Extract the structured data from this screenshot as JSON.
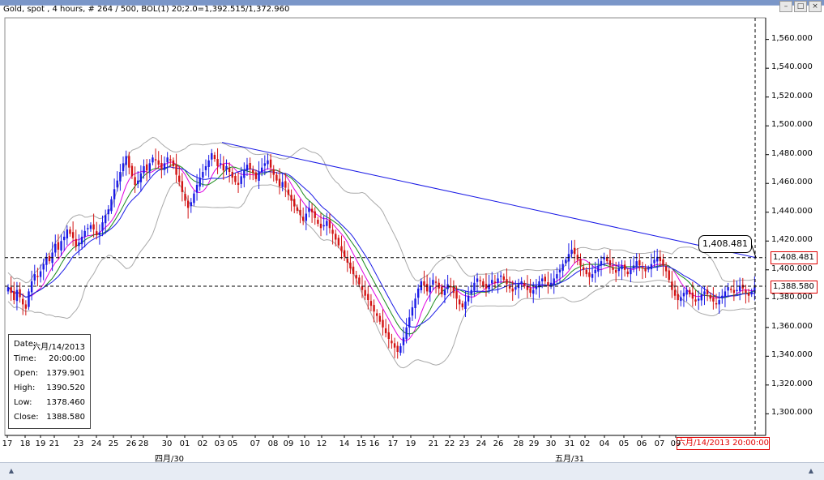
{
  "header": {
    "info_text": "Gold, spot , 4 hours, # 264 / 500,  BOL(1) 20;2.0=1,392.515/1,372.960"
  },
  "date_box": {
    "rows": [
      {
        "k": "Date:",
        "v": "六月/14/2013"
      },
      {
        "k": "Time:",
        "v": "20:00:00"
      },
      {
        "k": "Open:",
        "v": "1379.901"
      },
      {
        "k": "High:",
        "v": "1390.520"
      },
      {
        "k": "Low:",
        "v": "1378.460"
      },
      {
        "k": "Close:",
        "v": "1388.580"
      }
    ]
  },
  "crosshair_label": "六月/14/2013 20:00:00",
  "price_labels": {
    "upper_line": "1,408.481",
    "lower_line": "1,388.580",
    "callout": "1,408.481"
  },
  "colors": {
    "up_candle": "#1a1ae6",
    "down_candle": "#d21414",
    "bollinger": "#a9a9a9",
    "ma_fast": "#e000e0",
    "ma_mid": "#1a8a1a",
    "ma_slow": "#1a1ae6",
    "trendline": "#1a1ae6",
    "label_border": "#e00000"
  },
  "chart_data": {
    "type": "candlestick",
    "instrument": "Gold, spot",
    "interval": "4 hours",
    "y_axis": {
      "min": 1285,
      "max": 1575,
      "ticks": [
        1300,
        1320,
        1340,
        1360,
        1380,
        1400,
        1420,
        1440,
        1460,
        1480,
        1500,
        1520,
        1540,
        1560
      ],
      "tick_labels": [
        "1,300.000",
        "1,320.000",
        "1,340.000",
        "1,360.000",
        "1,380.000",
        "1,400.000",
        "1,420.000",
        "1,440.000",
        "1,460.000",
        "1,480.000",
        "1,500.000",
        "1,520.000",
        "1,540.000",
        "1,560.000"
      ]
    },
    "x_axis": {
      "day_labels": [
        "17",
        "18",
        "19",
        "21",
        "23",
        "24",
        "25",
        "26",
        "28",
        "30",
        "01",
        "02",
        "03",
        "05",
        "07",
        "08",
        "09",
        "10",
        "12",
        "14",
        "15",
        "16",
        "17",
        "19",
        "21",
        "22",
        "23",
        "24",
        "26",
        "28",
        "29",
        "30",
        "31",
        "02",
        "04",
        "05",
        "06",
        "07",
        "09"
      ],
      "month_labels": [
        "四月/30",
        "五月/31"
      ]
    },
    "horizontal_lines": [
      1408.481,
      1388.58
    ],
    "trendline": {
      "start_price": 1488.5,
      "end_price": 1408.481
    },
    "closes": [
      1388,
      1384,
      1379,
      1386,
      1381,
      1376,
      1373,
      1385,
      1392,
      1397,
      1395,
      1399,
      1404,
      1409,
      1406,
      1412,
      1418,
      1414,
      1420,
      1423,
      1428,
      1425,
      1422,
      1416,
      1419,
      1423,
      1427,
      1429,
      1431,
      1428,
      1424,
      1426,
      1433,
      1438,
      1442,
      1449,
      1456,
      1462,
      1468,
      1474,
      1479,
      1471,
      1465,
      1459,
      1462,
      1467,
      1472,
      1469,
      1474,
      1478,
      1476,
      1473,
      1470,
      1474,
      1478,
      1476,
      1472,
      1466,
      1461,
      1454,
      1448,
      1443,
      1447,
      1453,
      1459,
      1464,
      1468,
      1472,
      1476,
      1481,
      1477,
      1472,
      1474,
      1469,
      1472,
      1468,
      1464,
      1461,
      1459,
      1465,
      1469,
      1473,
      1470,
      1467,
      1463,
      1468,
      1471,
      1474,
      1476,
      1471,
      1466,
      1462,
      1458,
      1461,
      1457,
      1452,
      1448,
      1444,
      1441,
      1438,
      1434,
      1439,
      1443,
      1440,
      1436,
      1432,
      1429,
      1431,
      1434,
      1429,
      1425,
      1421,
      1417,
      1413,
      1409,
      1405,
      1401,
      1397,
      1394,
      1390,
      1386,
      1382,
      1379,
      1375,
      1371,
      1368,
      1364,
      1360,
      1356,
      1352,
      1349,
      1346,
      1343,
      1347,
      1353,
      1360,
      1367,
      1374,
      1380,
      1387,
      1392,
      1389,
      1385,
      1389,
      1393,
      1391,
      1387,
      1383,
      1386,
      1390,
      1388,
      1384,
      1380,
      1376,
      1374,
      1378,
      1382,
      1386,
      1391,
      1394,
      1392,
      1389,
      1387,
      1390,
      1393,
      1391,
      1394,
      1396,
      1393,
      1390,
      1387,
      1385,
      1388,
      1390,
      1392,
      1389,
      1386,
      1384,
      1386,
      1389,
      1392,
      1394,
      1392,
      1389,
      1391,
      1394,
      1397,
      1400,
      1404,
      1407,
      1411,
      1414,
      1411,
      1407,
      1403,
      1400,
      1397,
      1395,
      1397,
      1400,
      1403,
      1406,
      1409,
      1406,
      1403,
      1400,
      1398,
      1401,
      1403,
      1400,
      1397,
      1400,
      1403,
      1406,
      1403,
      1401,
      1399,
      1401,
      1404,
      1407,
      1409,
      1406,
      1403,
      1399,
      1393,
      1386,
      1382,
      1379,
      1381,
      1384,
      1386,
      1383,
      1380,
      1378,
      1380,
      1383,
      1385,
      1383,
      1380,
      1378,
      1376,
      1379,
      1382,
      1385,
      1388,
      1386,
      1384,
      1386,
      1389,
      1387,
      1384,
      1382,
      1385,
      1388
    ]
  }
}
